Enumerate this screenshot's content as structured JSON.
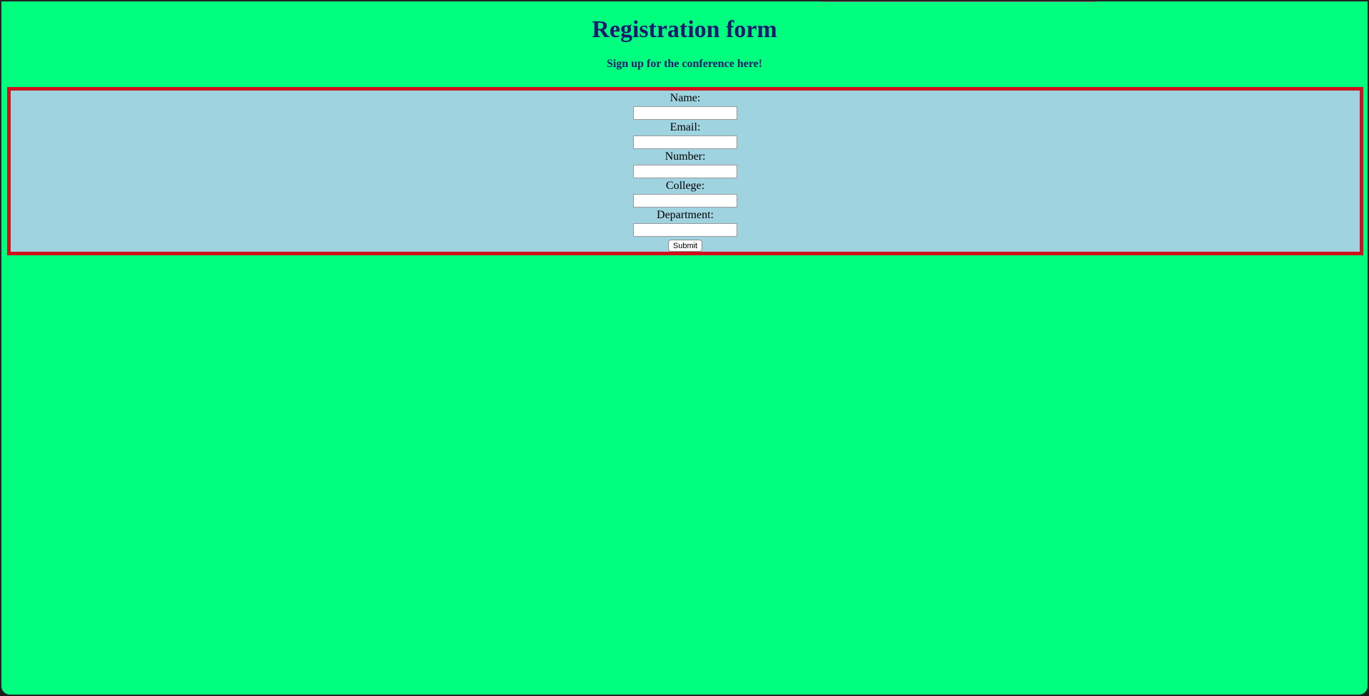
{
  "page": {
    "title": "Registration form",
    "subtitle": "Sign up for the conference here!"
  },
  "form": {
    "fields": [
      {
        "label": "Name:",
        "value": "",
        "placeholder": ""
      },
      {
        "label": "Email:",
        "value": "",
        "placeholder": ""
      },
      {
        "label": "Number:",
        "value": "",
        "placeholder": ""
      },
      {
        "label": "College:",
        "value": "",
        "placeholder": ""
      },
      {
        "label": "Department:",
        "value": "",
        "placeholder": ""
      }
    ],
    "submit_label": "Submit"
  },
  "colors": {
    "page_background": "#00ff7f",
    "heading_text": "#191970",
    "form_background": "#9fd3df",
    "form_border": "#d0101a"
  }
}
